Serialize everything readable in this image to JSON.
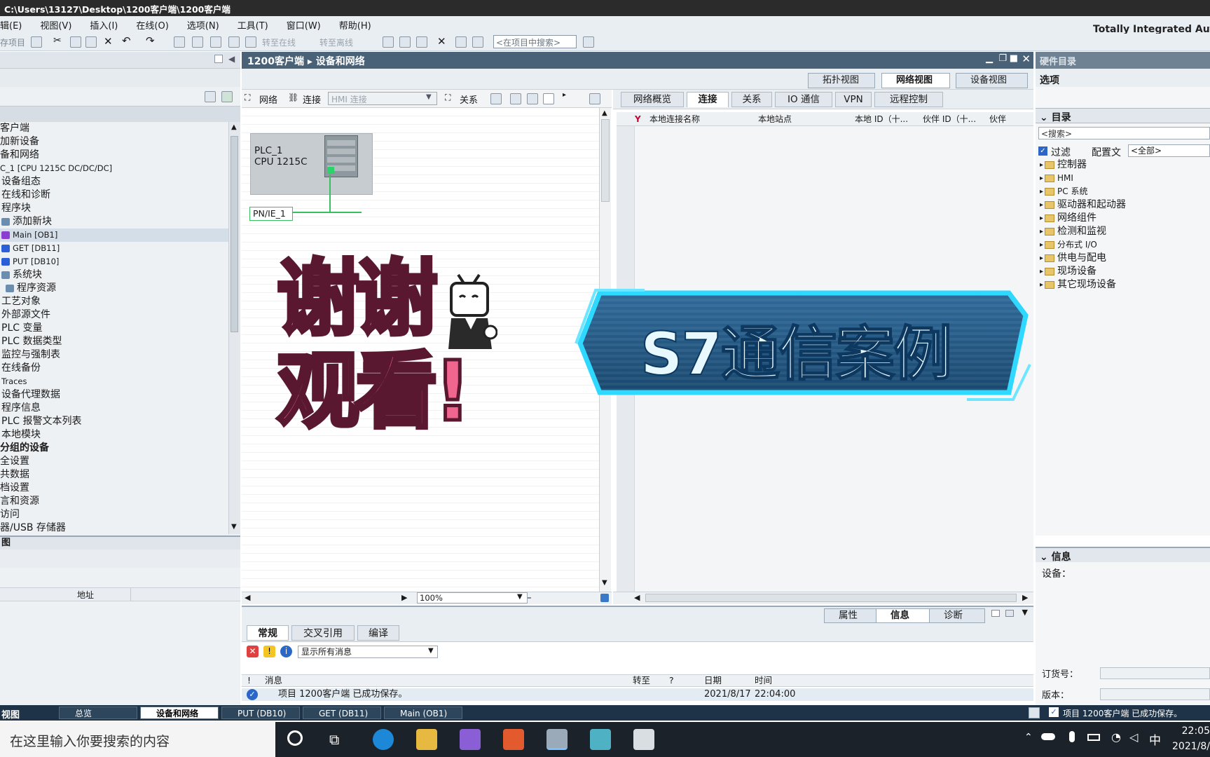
{
  "window": {
    "title": "C:\\Users\\13127\\Desktop\\1200客户端\\1200客户端",
    "brand": "Totally Integrated Auto"
  },
  "menu": [
    "辑(E)",
    "视图(V)",
    "插入(I)",
    "在线(O)",
    "选项(N)",
    "工具(T)",
    "窗口(W)",
    "帮助(H)"
  ],
  "toolbar": {
    "save_label": "存项目",
    "go_online": "转至在线",
    "go_offline": "转至离线",
    "search_placeholder": "<在项目中搜索>"
  },
  "project_tree": {
    "items": [
      {
        "label": "客户端",
        "kind": "root"
      },
      {
        "label": "加新设备",
        "kind": "item"
      },
      {
        "label": "备和网络",
        "kind": "item"
      },
      {
        "label": "C_1 [CPU 1215C DC/DC/DC]",
        "kind": "plc",
        "small": true
      },
      {
        "label": "设备组态",
        "kind": "item"
      },
      {
        "label": "在线和诊断",
        "kind": "item"
      },
      {
        "label": "程序块",
        "kind": "item"
      },
      {
        "label": "添加新块",
        "kind": "item"
      },
      {
        "label": "Main [OB1]",
        "kind": "ob",
        "small": true,
        "selected": true
      },
      {
        "label": "GET [DB11]",
        "kind": "db",
        "small": true
      },
      {
        "label": "PUT [DB10]",
        "kind": "db",
        "small": true
      },
      {
        "label": "系统块",
        "kind": "item"
      },
      {
        "label": "程序资源",
        "kind": "item"
      },
      {
        "label": "工艺对象",
        "kind": "item"
      },
      {
        "label": "外部源文件",
        "kind": "item"
      },
      {
        "label": "PLC 变量",
        "kind": "item"
      },
      {
        "label": "PLC 数据类型",
        "kind": "item"
      },
      {
        "label": "监控与强制表",
        "kind": "item"
      },
      {
        "label": "在线备份",
        "kind": "item"
      },
      {
        "label": "Traces",
        "kind": "item",
        "small": true
      },
      {
        "label": "设备代理数据",
        "kind": "item"
      },
      {
        "label": "程序信息",
        "kind": "item"
      },
      {
        "label": "PLC 报警文本列表",
        "kind": "item"
      },
      {
        "label": "本地模块",
        "kind": "item"
      },
      {
        "label": "分组的设备",
        "kind": "group"
      },
      {
        "label": "全设置",
        "kind": "item"
      },
      {
        "label": "共数据",
        "kind": "item"
      },
      {
        "label": "档设置",
        "kind": "item"
      },
      {
        "label": "言和资源",
        "kind": "item"
      },
      {
        "label": "访问",
        "kind": "item"
      },
      {
        "label": "器/USB 存储器",
        "kind": "item"
      }
    ],
    "detail_title": "图",
    "detail_col": "地址"
  },
  "editor": {
    "breadcrumb": [
      "1200客户端",
      "设备和网络"
    ],
    "view_tabs": [
      {
        "label": "拓扑视图",
        "active": false
      },
      {
        "label": "网络视图",
        "active": true
      },
      {
        "label": "设备视图",
        "active": false
      }
    ],
    "net_toolbar": {
      "network": "网络",
      "connection": "连接",
      "hmi_connection": "HMI 连接",
      "relations": "关系"
    },
    "plc": {
      "name": "PLC_1",
      "cpu": "CPU 1215C"
    },
    "subnet": "PN/IE_1",
    "zoom": "100%"
  },
  "table": {
    "tabs": [
      {
        "label": "网络概览",
        "active": false
      },
      {
        "label": "连接",
        "active": true
      },
      {
        "label": "关系",
        "active": false
      },
      {
        "label": "IO 通信",
        "active": false
      },
      {
        "label": "VPN",
        "active": false
      },
      {
        "label": "远程控制",
        "active": false
      }
    ],
    "columns": [
      "本地连接名称",
      "本地站点",
      "本地 ID（十...",
      "伙伴 ID（十...",
      "伙伴"
    ]
  },
  "inspector": {
    "tabs": [
      {
        "label": "属性",
        "active": false
      },
      {
        "label": "信息",
        "active": true
      },
      {
        "label": "诊断",
        "active": false
      }
    ],
    "subtabs": [
      {
        "label": "常规",
        "active": true
      },
      {
        "label": "交叉引用",
        "active": false
      },
      {
        "label": "编译",
        "active": false
      }
    ],
    "filter": "显示所有消息",
    "columns": {
      "flag": "!",
      "message": "消息",
      "goto": "转至",
      "q": "?",
      "date": "日期",
      "time": "时间"
    },
    "rows": [
      {
        "message": "项目 1200客户端 已成功保存。",
        "date": "2021/8/17",
        "time": "22:04:00"
      }
    ]
  },
  "catalog": {
    "title": "硬件目录",
    "options": "选项",
    "directory": "目录",
    "search": "<搜索>",
    "filter_label": "过滤",
    "profile_label": "配置文",
    "profile_value": "<全部>",
    "items": [
      "控制器",
      "HMI",
      "PC 系统",
      "驱动器和起动器",
      "网络组件",
      "检测和监视",
      "分布式 I/O",
      "供电与配电",
      "现场设备",
      "其它现场设备"
    ],
    "info_title": "信息",
    "device_label": "设备：",
    "order_label": "订货号：",
    "version_label": "版本："
  },
  "statusbar": {
    "portal": "视图",
    "tabs": [
      {
        "label": "总览",
        "active": false
      },
      {
        "label": "设备和网络",
        "active": true
      },
      {
        "label": "PUT (DB10)",
        "active": false
      },
      {
        "label": "GET (DB11)",
        "active": false
      },
      {
        "label": "Main (OB1)",
        "active": false
      }
    ],
    "message": "项目 1200客户端 已成功保存。"
  },
  "taskbar": {
    "search_placeholder": "在这里输入你要搜索的内容",
    "time": "22:05",
    "date": "2021/8/",
    "ime": "中"
  },
  "overlay": {
    "thanks_line1": "谢谢",
    "thanks_line2": "观看!",
    "banner": "S7通信案例"
  },
  "colors": {
    "accent": "#4a6278",
    "green_net": "#38c060",
    "overlay_pink": "#f0668f",
    "banner_cyan": "#2fd8ff"
  }
}
